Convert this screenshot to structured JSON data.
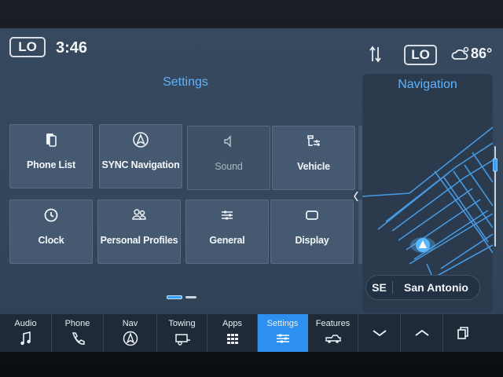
{
  "status": {
    "climate_left": "LO",
    "time": "3:46",
    "climate_right": "LO",
    "temperature": "86°",
    "icons": [
      "data-transfer-icon",
      "weather-icon"
    ]
  },
  "settings": {
    "title": "Settings",
    "tiles": [
      {
        "label": "Phone List",
        "icon": "phone-list-icon"
      },
      {
        "label": "SYNC Navigation",
        "icon": "sync-navigation-icon"
      },
      {
        "label": "Sound",
        "icon": "sound-icon"
      },
      {
        "label": "Vehicle",
        "icon": "vehicle-icon"
      },
      {
        "label": "Clock",
        "icon": "clock-icon"
      },
      {
        "label": "Personal Profiles",
        "icon": "profiles-icon"
      },
      {
        "label": "General",
        "icon": "sliders-icon"
      },
      {
        "label": "Display",
        "icon": "display-icon"
      }
    ]
  },
  "navigation": {
    "title": "Navigation",
    "heading": "SE",
    "city": "San Antonio"
  },
  "bottombar": {
    "items": [
      {
        "label": "Audio",
        "icon": "music-note-icon"
      },
      {
        "label": "Phone",
        "icon": "phone-icon"
      },
      {
        "label": "Nav",
        "icon": "navigation-icon"
      },
      {
        "label": "Towing",
        "icon": "trailer-icon"
      },
      {
        "label": "Apps",
        "icon": "apps-grid-icon"
      },
      {
        "label": "Settings",
        "icon": "settings-sliders-icon",
        "active": true
      },
      {
        "label": "Features",
        "icon": "truck-icon"
      }
    ],
    "extra_icons": [
      "chevron-down-icon",
      "chevron-up-icon",
      "windows-icon"
    ]
  },
  "colors": {
    "accent": "#3aa0ff",
    "title": "#5fb3ff",
    "active_tab": "#2d8ff0",
    "tile": "#455a70",
    "background": "#33465a"
  }
}
